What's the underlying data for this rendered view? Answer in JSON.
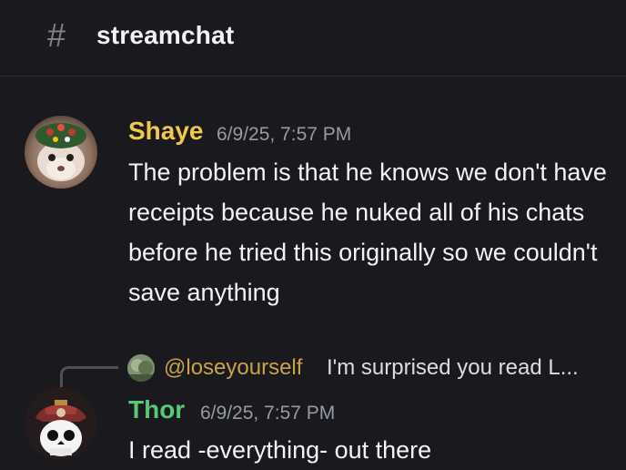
{
  "channel": {
    "icon": "hash-icon",
    "name": "streamchat"
  },
  "messages": [
    {
      "author": "Shaye",
      "author_color": "#f0c94a",
      "timestamp": "6/9/25, 7:57 PM",
      "text": "The problem is that he knows we don't have receipts because he nuked all of his chats before he tried this originally so we couldn't save anything"
    },
    {
      "reply_to": {
        "author": "@loseyourself",
        "preview": "I'm surprised you read L..."
      },
      "author": "Thor",
      "author_color": "#57c77a",
      "timestamp": "6/9/25, 7:57 PM",
      "text": "I read -everything- out there"
    }
  ]
}
